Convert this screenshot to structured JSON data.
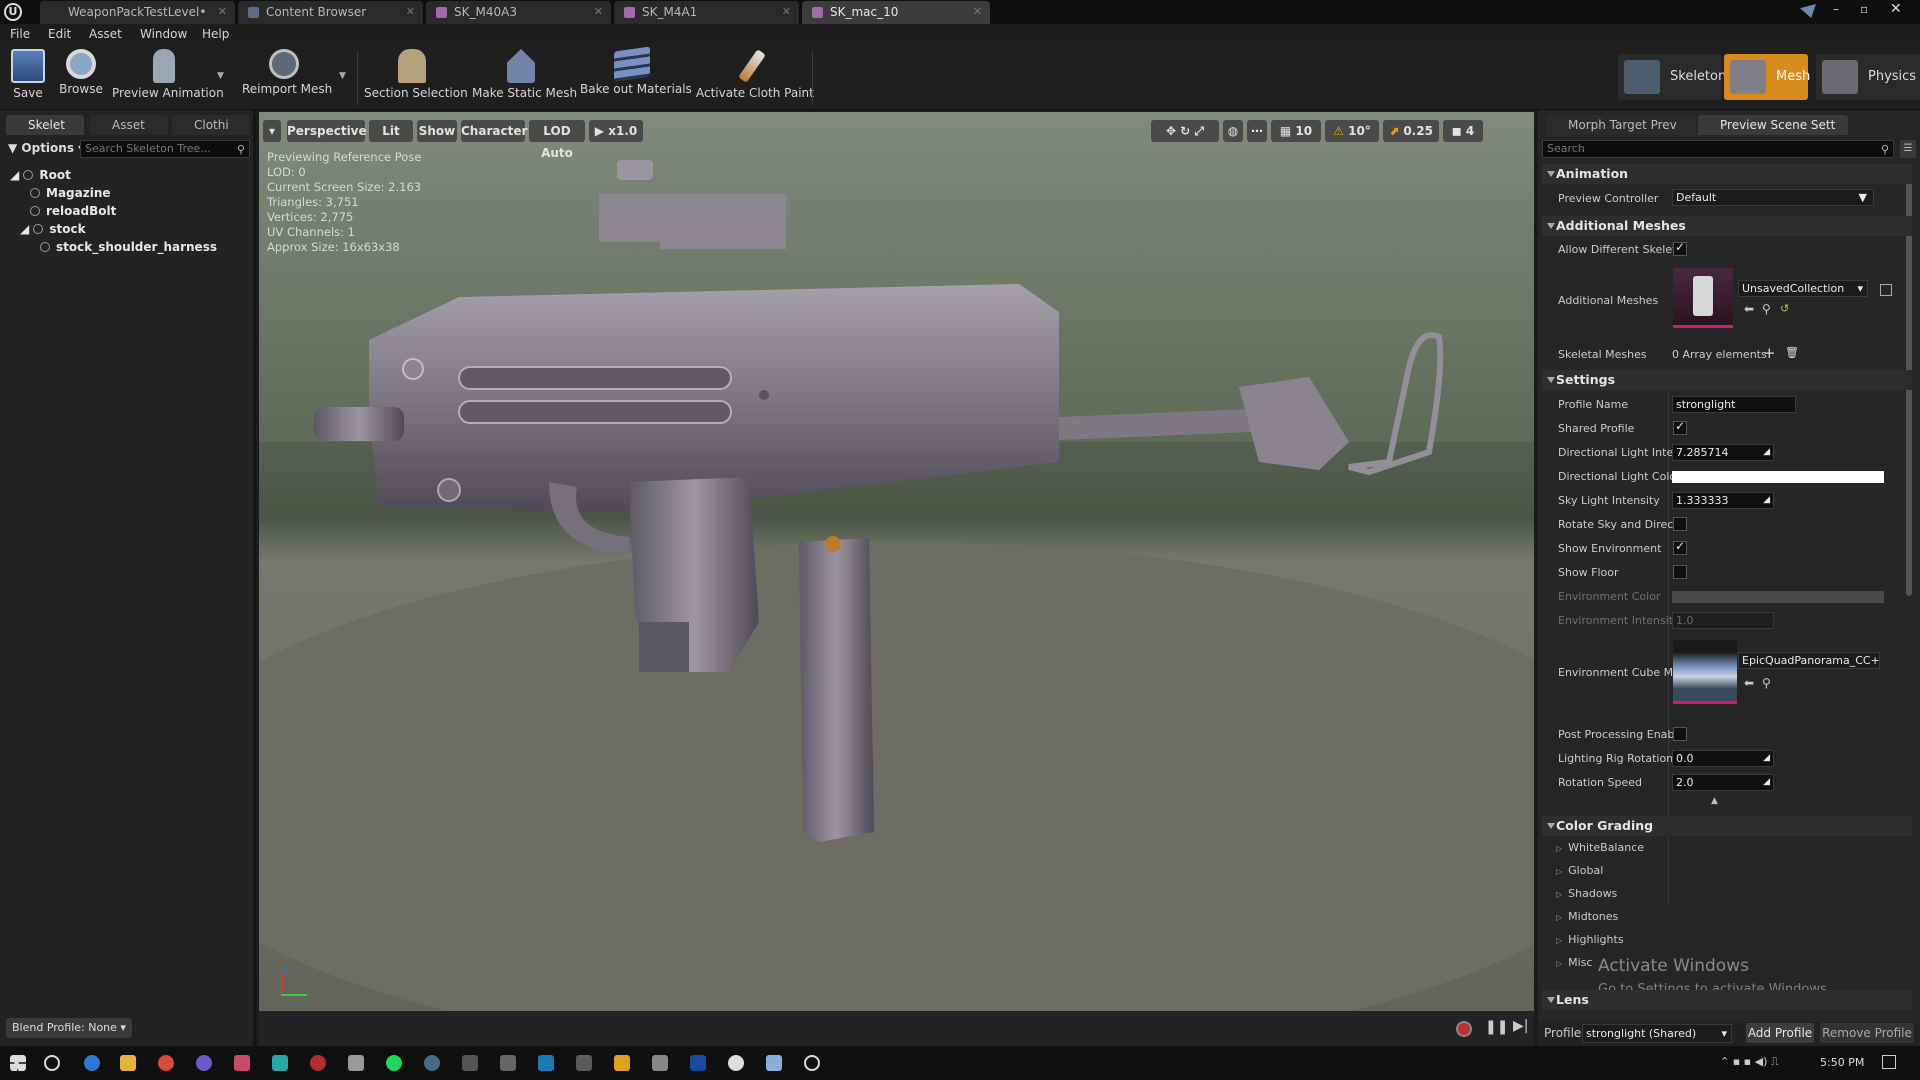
{
  "tabs": [
    {
      "label": "WeaponPackTestLevel•",
      "active": false
    },
    {
      "label": "Content Browser",
      "active": false
    },
    {
      "label": "SK_M40A3",
      "active": false
    },
    {
      "label": "SK_M4A1",
      "active": false
    },
    {
      "label": "SK_mac_10",
      "active": true
    }
  ],
  "menu": [
    "File",
    "Edit",
    "Asset",
    "Window",
    "Help"
  ],
  "toolbar": {
    "save": "Save",
    "browse": "Browse",
    "preview_animation": "Preview Animation",
    "reimport_mesh": "Reimport Mesh",
    "section_selection": "Section Selection",
    "make_static_mesh": "Make Static Mesh",
    "bake_out_materials": "Bake out Materials",
    "activate_cloth_paint": "Activate Cloth Paint"
  },
  "modes": {
    "skeleton": "Skeleton",
    "mesh": "Mesh",
    "physics": "Physics"
  },
  "left": {
    "tabs": [
      "Skelet",
      "Asset",
      "Clothi"
    ],
    "options": "Options",
    "search_placeholder": "Search Skeleton Tree...",
    "tree": [
      "Root",
      "Magazine",
      "reloadBolt",
      "stock",
      "stock_shoulder_harness"
    ],
    "blend_profile": "Blend Profile: None"
  },
  "viewport": {
    "buttons": {
      "perspective": "Perspective",
      "lit": "Lit",
      "show": "Show",
      "character": "Character",
      "lod": "LOD Auto",
      "speed": "x1.0"
    },
    "right_values": {
      "grid": "10",
      "angle": "10°",
      "scale": "0.25",
      "camera": "4"
    },
    "info": [
      "Previewing Reference Pose",
      "LOD: 0",
      "Current Screen Size: 2.163",
      "Triangles: 3,751",
      "Vertices: 2,775",
      "UV Channels: 1",
      "Approx Size: 16x63x38"
    ]
  },
  "right": {
    "tabs": [
      "Morph Target Prev",
      "Preview Scene Sett"
    ],
    "search_placeholder": "Search",
    "sections": {
      "animation": "Animation",
      "additional_meshes": "Additional Meshes",
      "settings": "Settings",
      "color_grading": "Color Grading",
      "lens": "Lens"
    },
    "preview_controller": {
      "label": "Preview Controller",
      "value": "Default"
    },
    "allow_different": {
      "label": "Allow Different Skelet",
      "checked": true
    },
    "additional_meshes": {
      "label": "Additional Meshes",
      "value": "UnsavedCollection"
    },
    "skeletal_meshes": {
      "label": "Skeletal Meshes",
      "value": "0 Array elements"
    },
    "props": {
      "profile_name": {
        "label": "Profile Name",
        "value": "stronglight"
      },
      "shared_profile": {
        "label": "Shared Profile",
        "checked": true
      },
      "dir_light_int": {
        "label": "Directional Light Inter",
        "value": "7.285714"
      },
      "dir_light_col": {
        "label": "Directional Light Colo"
      },
      "sky_light": {
        "label": "Sky Light Intensity",
        "value": "1.333333"
      },
      "rotate_sky": {
        "label": "Rotate Sky and Direct",
        "checked": false
      },
      "show_env": {
        "label": "Show Environment",
        "checked": true
      },
      "show_floor": {
        "label": "Show Floor",
        "checked": false
      },
      "env_color": {
        "label": "Environment Color"
      },
      "env_intensity": {
        "label": "Environment Intensity",
        "value": "1.0"
      },
      "env_cube": {
        "label": "Environment Cube Ma",
        "value": "EpicQuadPanorama_CC+E"
      },
      "post_proc": {
        "label": "Post Processing Enab",
        "checked": false
      },
      "rig_rotation": {
        "label": "Lighting Rig Rotation",
        "value": "0.0"
      },
      "rot_speed": {
        "label": "Rotation Speed",
        "value": "2.0"
      }
    },
    "color_grading": [
      "WhiteBalance",
      "Global",
      "Shadows",
      "Midtones",
      "Highlights",
      "Misc"
    ],
    "footer": {
      "profile_label": "Profile",
      "profile_value": "stronglight (Shared)",
      "add": "Add Profile",
      "remove": "Remove Profile"
    },
    "watermark": {
      "title": "Activate Windows",
      "sub": "Go to Settings to activate Windows."
    }
  },
  "taskbar": {
    "time": "5:50 PM"
  }
}
